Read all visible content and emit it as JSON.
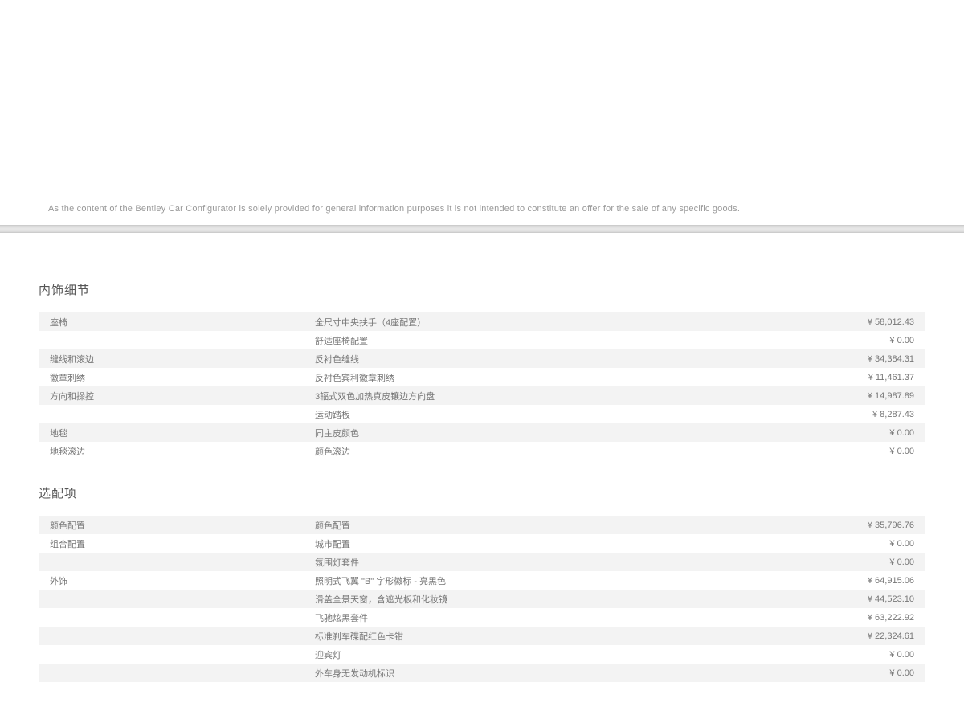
{
  "disclaimer": "As the content of the Bentley Car Configurator is solely provided for general information purposes it is not intended to constitute an offer for the sale of any specific goods.",
  "sections": [
    {
      "title": "内饰细节",
      "rows": [
        {
          "cat": "座椅",
          "desc": "全尺寸中央扶手（4座配置）",
          "price": "¥ 58,012.43"
        },
        {
          "cat": "",
          "desc": "舒适座椅配置",
          "price": "¥ 0.00"
        },
        {
          "cat": "缝线和滚边",
          "desc": "反衬色缝线",
          "price": "¥ 34,384.31"
        },
        {
          "cat": "徽章刺绣",
          "desc": "反衬色宾利徽章刺绣",
          "price": "¥ 11,461.37"
        },
        {
          "cat": "方向和操控",
          "desc": "3辐式双色加热真皮镶边方向盘",
          "price": "¥ 14,987.89"
        },
        {
          "cat": "",
          "desc": "运动踏板",
          "price": "¥ 8,287.43"
        },
        {
          "cat": "地毯",
          "desc": "同主皮颜色",
          "price": "¥ 0.00"
        },
        {
          "cat": "地毯滚边",
          "desc": "颜色滚边",
          "price": "¥ 0.00"
        }
      ]
    },
    {
      "title": "选配项",
      "rows": [
        {
          "cat": "颜色配置",
          "desc": "颜色配置",
          "price": "¥ 35,796.76"
        },
        {
          "cat": "组合配置",
          "desc": "城市配置",
          "price": "¥ 0.00"
        },
        {
          "cat": "",
          "desc": "氛围灯套件",
          "price": "¥ 0.00"
        },
        {
          "cat": "外饰",
          "desc": "照明式飞翼 \"B\" 字形徽标 - 亮黑色",
          "price": "¥ 64,915.06"
        },
        {
          "cat": "",
          "desc": "滑盖全景天窗，含遮光板和化妆镜",
          "price": "¥ 44,523.10"
        },
        {
          "cat": "",
          "desc": "飞驰炫黑套件",
          "price": "¥ 63,222.92"
        },
        {
          "cat": "",
          "desc": "标准刹车碟配红色卡钳",
          "price": "¥ 22,324.61"
        },
        {
          "cat": "",
          "desc": "迎宾灯",
          "price": "¥ 0.00"
        },
        {
          "cat": "",
          "desc": "外车身无发动机标识",
          "price": "¥ 0.00"
        }
      ]
    }
  ]
}
